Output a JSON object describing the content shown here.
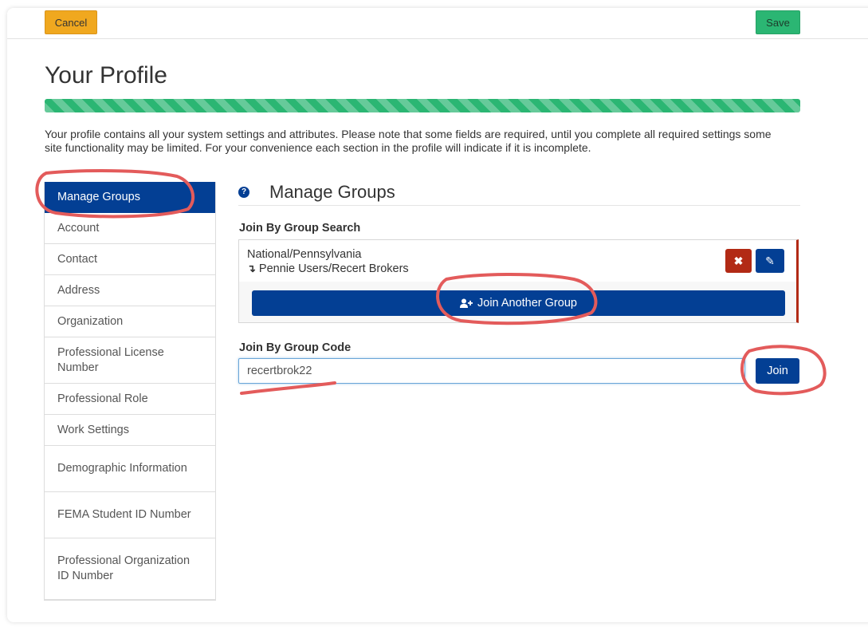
{
  "toolbar": {
    "cancel_label": "Cancel",
    "save_label": "Save"
  },
  "page": {
    "title": "Your Profile",
    "progress_percent": 100,
    "intro": "Your profile contains all your system settings and attributes. Please note that some fields are required, until you complete all required settings some site functionality may be limited. For your convenience each section in the profile will indicate if it is incomplete."
  },
  "sidebar": {
    "items": [
      {
        "label": "Manage Groups",
        "active": true
      },
      {
        "label": "Account"
      },
      {
        "label": "Contact"
      },
      {
        "label": "Address"
      },
      {
        "label": "Organization"
      },
      {
        "label": "Professional License Number"
      },
      {
        "label": "Professional Role"
      },
      {
        "label": "Work Settings"
      },
      {
        "label": "Demographic Information"
      },
      {
        "label": "FEMA Student ID Number"
      },
      {
        "label": "Professional Organization ID Number"
      }
    ]
  },
  "main": {
    "help_icon_glyph": "?",
    "section_title": "Manage Groups",
    "search_label": "Join By Group Search",
    "group": {
      "path": "National/Pennsylvania",
      "sub_arrow": "↴",
      "sub": "Pennie Users/Recert Brokers",
      "remove_glyph": "✖",
      "edit_glyph": "✎"
    },
    "join_another_label": "Join Another Group",
    "code_label": "Join By Group Code",
    "code_value": "recertbrok22",
    "join_label": "Join"
  },
  "colors": {
    "primary": "#033f94",
    "success": "#2bb673",
    "warning": "#f0a81f",
    "danger": "#b22a15",
    "annotation": "#e35b5b"
  },
  "icons": {
    "help": "question-circle-icon",
    "remove": "close-icon",
    "edit": "pencil-icon",
    "add_user": "add-user-icon"
  }
}
